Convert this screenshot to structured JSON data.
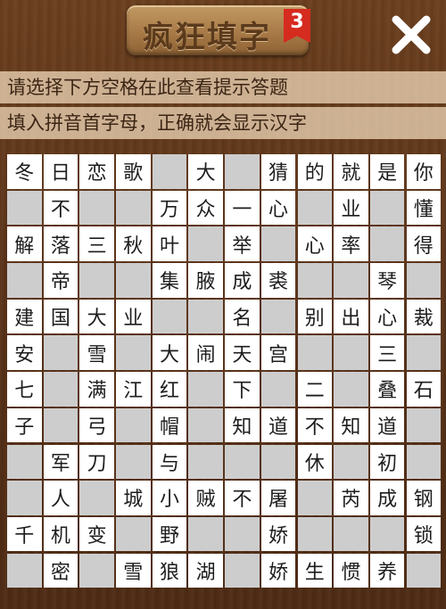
{
  "header": {
    "title": "疯狂填字",
    "level": "3",
    "close_icon": "close-icon"
  },
  "hints": {
    "line1": "请选择下方空格在此查看提示答题",
    "line2": "填入拼音首字母，正确就会显示汉字"
  },
  "grid": [
    [
      "冬",
      "日",
      "恋",
      "歌",
      "",
      "大",
      "",
      "猜",
      "的",
      "就",
      "是",
      "你"
    ],
    [
      "",
      "不",
      "",
      "",
      "万",
      "众",
      "一",
      "心",
      "",
      "业",
      "",
      "懂"
    ],
    [
      "解",
      "落",
      "三",
      "秋",
      "叶",
      "",
      "举",
      "",
      "心",
      "率",
      "",
      "得"
    ],
    [
      "",
      "帝",
      "",
      "",
      "集",
      "腋",
      "成",
      "裘",
      "",
      "",
      "琴",
      ""
    ],
    [
      "建",
      "国",
      "大",
      "业",
      "",
      "",
      "名",
      "",
      "别",
      "出",
      "心",
      "裁"
    ],
    [
      "安",
      "",
      "雪",
      "",
      "大",
      "闹",
      "天",
      "宫",
      "",
      "",
      "三",
      ""
    ],
    [
      "七",
      "",
      "满",
      "江",
      "红",
      "",
      "下",
      "",
      "二",
      "",
      "叠",
      "石"
    ],
    [
      "子",
      "",
      "弓",
      "",
      "帽",
      "",
      "知",
      "道",
      "不",
      "知",
      "道",
      ""
    ],
    [
      "",
      "军",
      "刀",
      "",
      "与",
      "",
      "",
      "",
      "休",
      "",
      "初",
      ""
    ],
    [
      "",
      "人",
      "",
      "城",
      "小",
      "贼",
      "不",
      "屠",
      "",
      "芮",
      "成",
      "钢"
    ],
    [
      "千",
      "机",
      "变",
      "",
      "野",
      "",
      "",
      "娇",
      "",
      "",
      "",
      "锁"
    ],
    [
      "",
      "密",
      "",
      "雪",
      "狼",
      "湖",
      "",
      "娇",
      "生",
      "惯",
      "养",
      ""
    ]
  ],
  "colors": {
    "board_bg": "#5a3518",
    "empty_cell": "#cdcdcd",
    "filled_cell": "#ffffff",
    "badge": "#d62b1f"
  }
}
